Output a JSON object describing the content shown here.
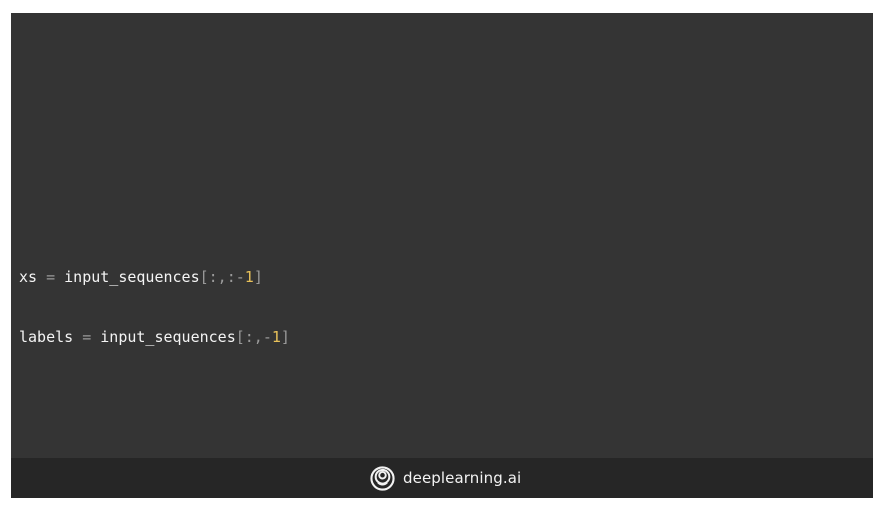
{
  "code": {
    "line1": {
      "var": "xs",
      "eq": " = ",
      "obj": "input_sequences",
      "open": "[",
      "slice_a": ":,:-",
      "num": "1",
      "close": "]"
    },
    "line2": {
      "var": "labels",
      "eq": " = ",
      "obj": "input_sequences",
      "open": "[",
      "slice_a": ":,-",
      "num": "1",
      "close": "]"
    }
  },
  "footer": {
    "brand_text": "deeplearning.ai",
    "logo_icon": "deeplearning-logo-icon"
  },
  "colors": {
    "background": "#343434",
    "footer": "#262626",
    "number": "#e8c15a",
    "operator": "#9a9a9a",
    "text": "#f2f2f2"
  }
}
